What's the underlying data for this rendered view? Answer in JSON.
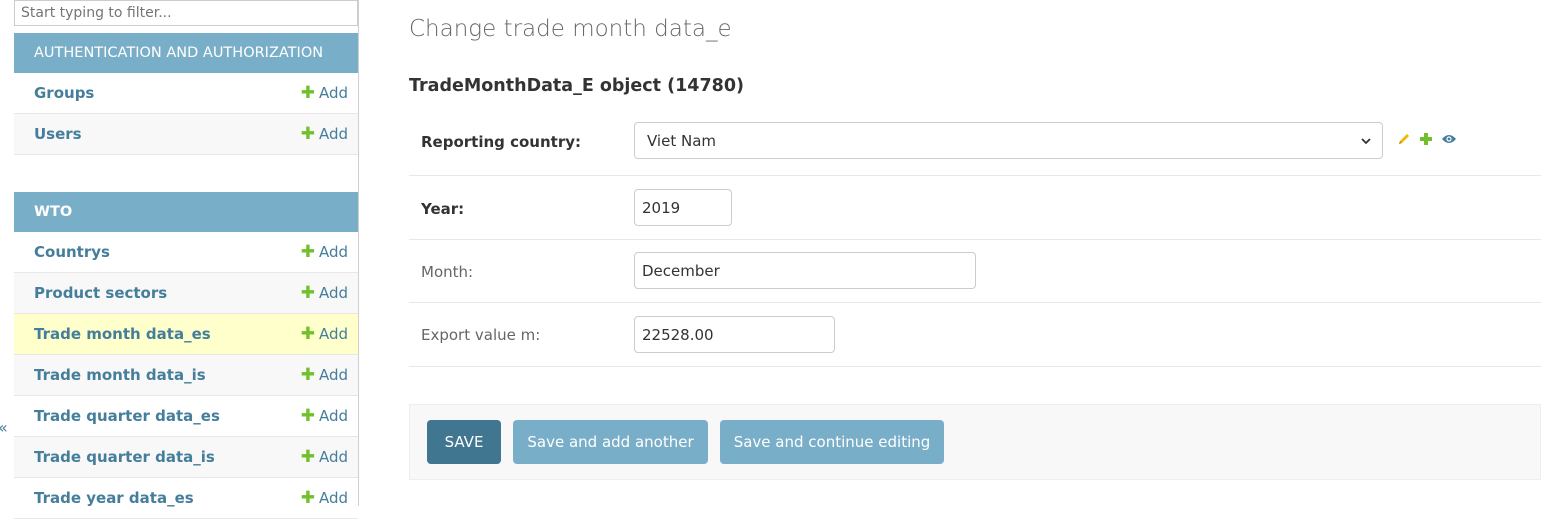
{
  "sidebar": {
    "filter_placeholder": "Start typing to filter...",
    "add_label": "Add",
    "apps": [
      {
        "name": "AUTHENTICATION AND AUTHORIZATION",
        "models": [
          "Groups",
          "Users"
        ]
      },
      {
        "name": "WTO",
        "models": [
          "Countrys",
          "Product sectors",
          "Trade month data_es",
          "Trade month data_is",
          "Trade quarter data_es",
          "Trade quarter data_is",
          "Trade year data_es"
        ]
      }
    ],
    "current_model": "Trade month data_es",
    "edge_glyph": "«"
  },
  "main": {
    "title": "Change trade month data_e",
    "object_title": "TradeMonthData_E object (14780)",
    "fields": {
      "reporting_country": {
        "label": "Reporting country:",
        "value": "Viet Nam"
      },
      "year": {
        "label": "Year:",
        "value": "2019"
      },
      "month": {
        "label": "Month:",
        "value": "December"
      },
      "export_value": {
        "label": "Export value m:",
        "value": "22528.00"
      }
    },
    "buttons": {
      "save": "SAVE",
      "save_add_another": "Save and add another",
      "save_continue": "Save and continue editing"
    }
  },
  "colors": {
    "header_bg": "#79aec8",
    "link": "#447e9b",
    "add_plus": "#70bf2b",
    "save_button": "#417690",
    "current_row": "#ffffcc",
    "edit_pencil": "#efb80b",
    "view_eye": "#447e9b"
  },
  "icons": {
    "add": "plus-icon",
    "change_related": "pencil-icon",
    "add_related": "plus-icon",
    "view_related": "eye-icon",
    "select": "chevron-down-icon"
  }
}
